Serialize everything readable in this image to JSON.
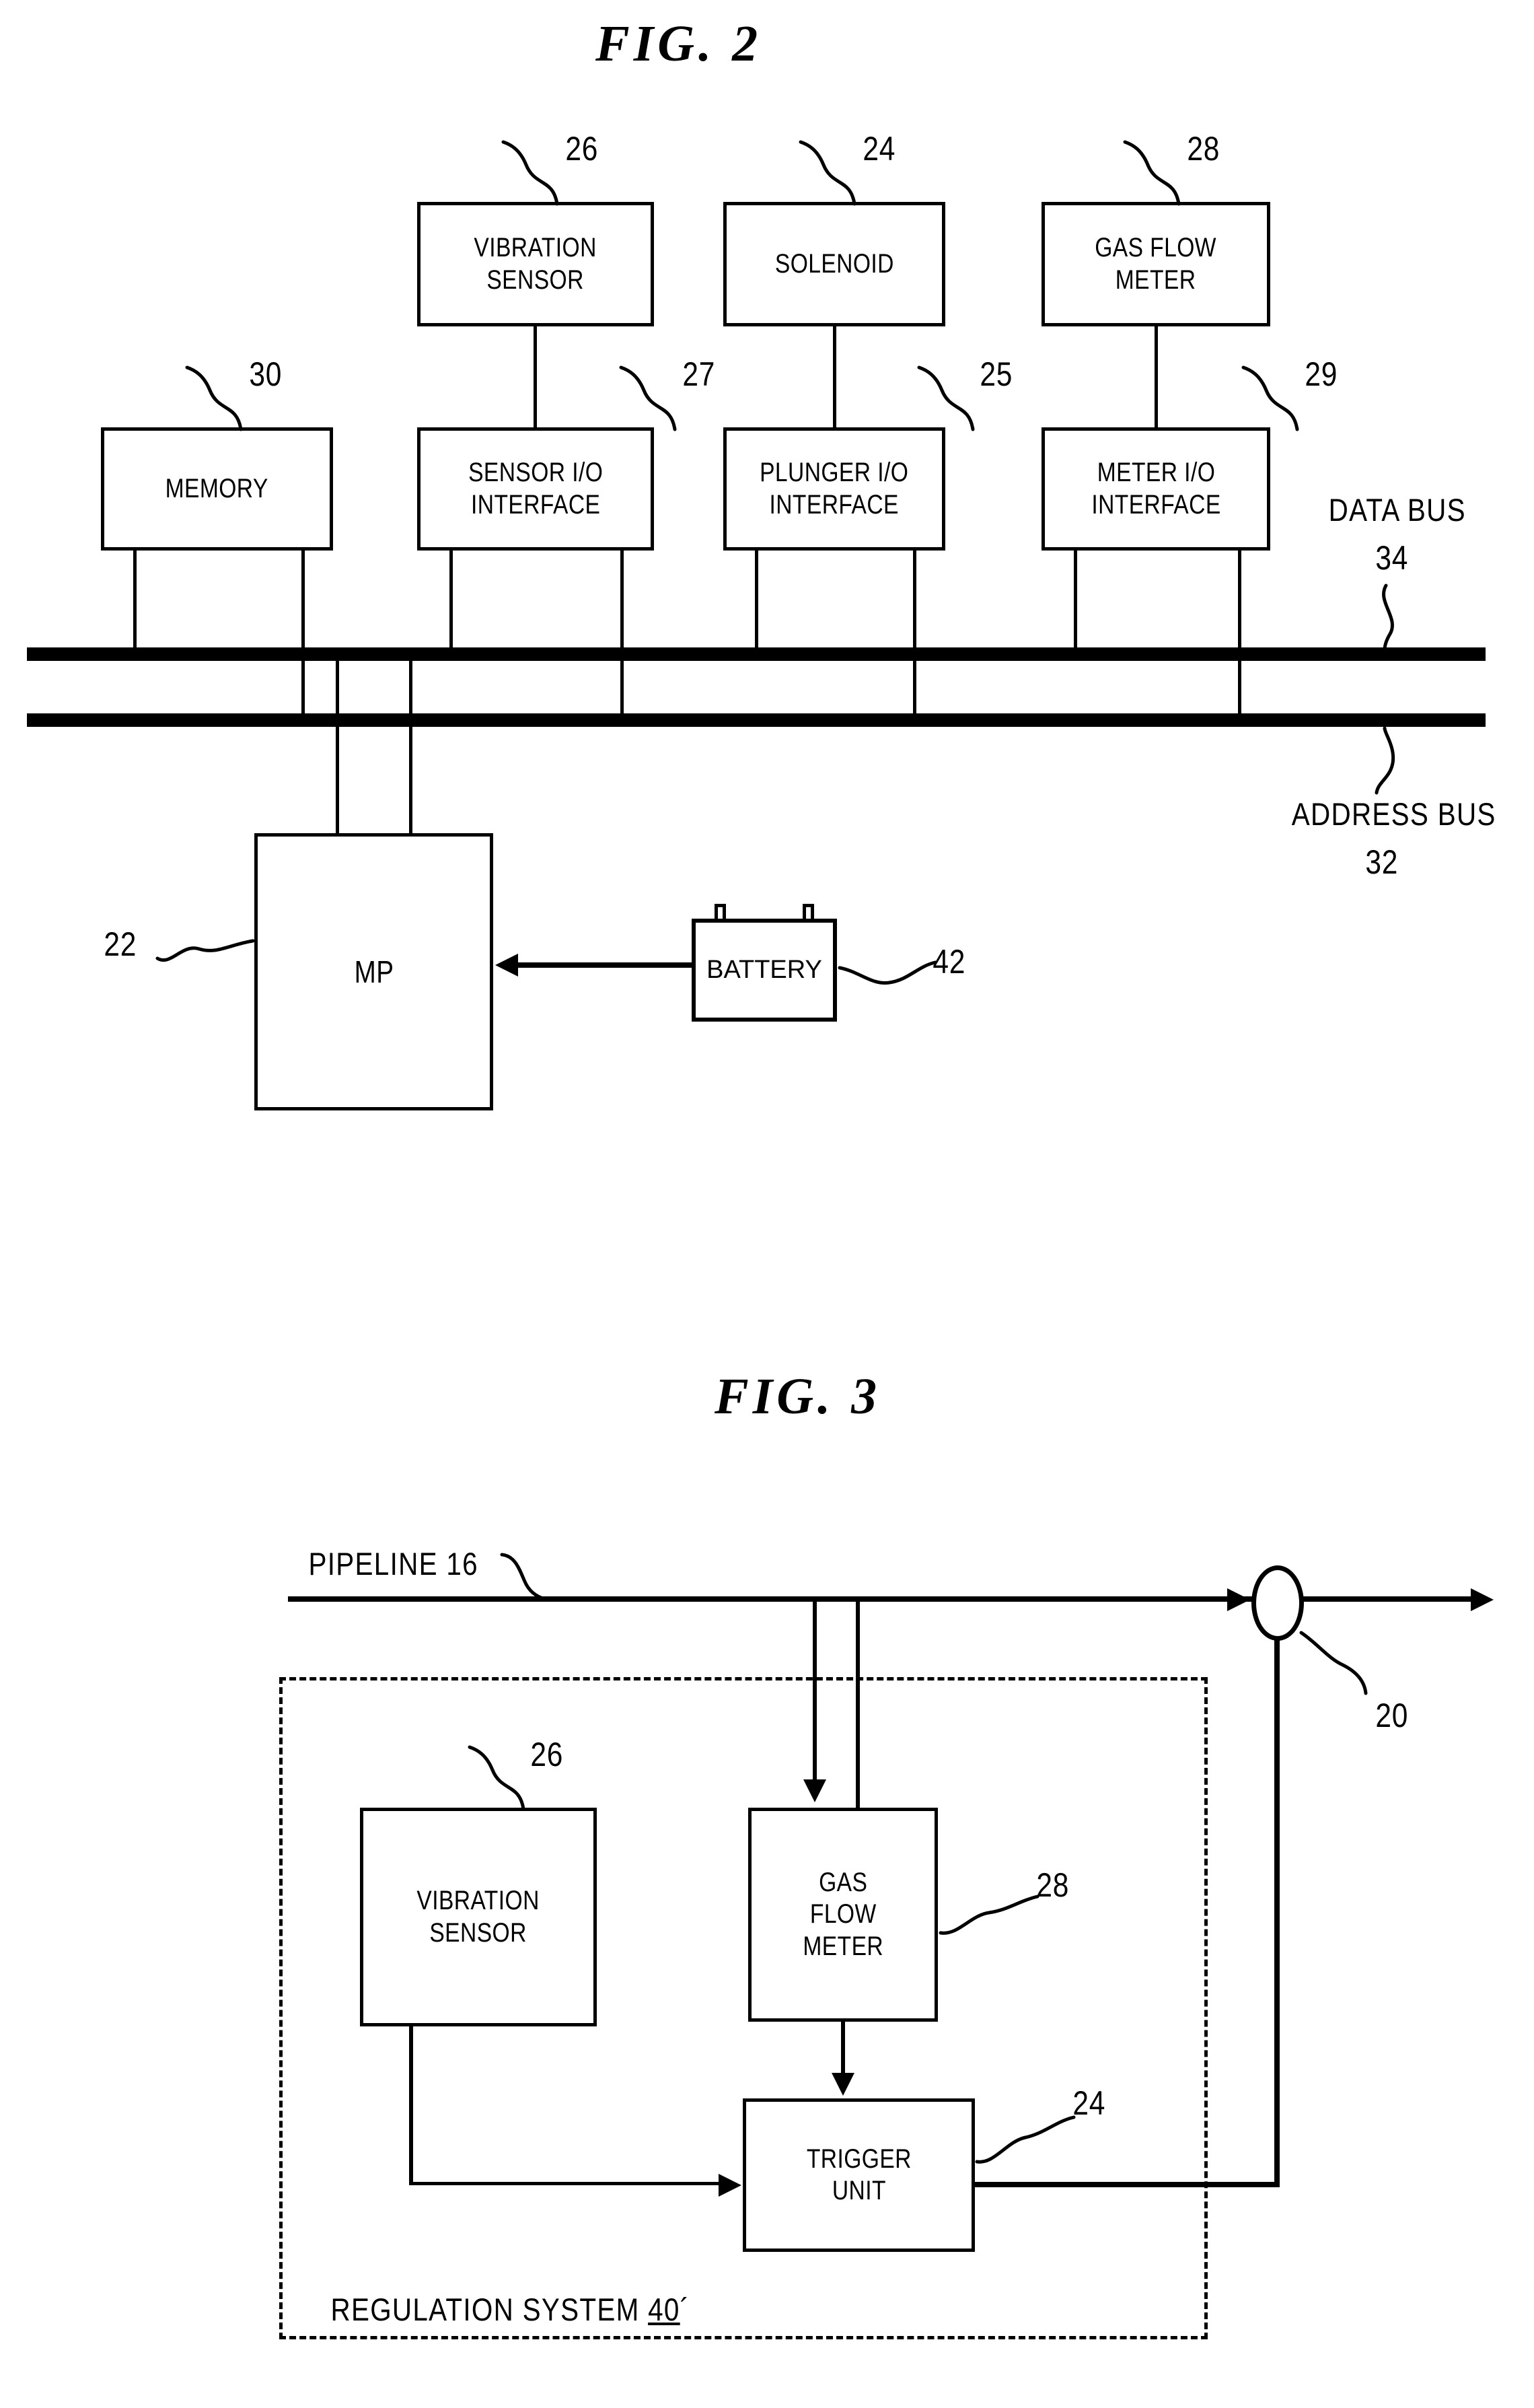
{
  "document": {
    "type": "patent-drawing-sheet",
    "figures": [
      "FIG. 2",
      "FIG. 3"
    ]
  },
  "fig2": {
    "title": "FIG. 2",
    "boxes": {
      "vibration_sensor": {
        "label": "VIBRATION\nSENSOR",
        "ref": "26"
      },
      "solenoid": {
        "label": "SOLENOID",
        "ref": "24"
      },
      "gas_flow_meter": {
        "label": "GAS FLOW\nMETER",
        "ref": "28"
      },
      "memory": {
        "label": "MEMORY",
        "ref": "30"
      },
      "sensor_io": {
        "label": "SENSOR I/O\nINTERFACE",
        "ref": "27"
      },
      "plunger_io": {
        "label": "PLUNGER I/O\nINTERFACE",
        "ref": "25"
      },
      "meter_io": {
        "label": "METER I/O\nINTERFACE",
        "ref": "29"
      },
      "mp": {
        "label": "MP",
        "ref": "22"
      },
      "battery": {
        "label": "BATTERY",
        "ref": "42"
      }
    },
    "buses": {
      "data_bus": {
        "label": "DATA BUS",
        "ref": "34"
      },
      "address_bus": {
        "label": "ADDRESS BUS",
        "ref": "32"
      }
    }
  },
  "fig3": {
    "title": "FIG. 3",
    "pipeline": {
      "label": "PIPELINE 16",
      "ref": "16"
    },
    "valve": {
      "ref": "20"
    },
    "boxes": {
      "vibration_sensor": {
        "label": "VIBRATION\nSENSOR",
        "ref": "26"
      },
      "gas_flow_meter": {
        "label": "GAS\nFLOW\nMETER",
        "ref": "28"
      },
      "trigger_unit": {
        "label": "TRIGGER\nUNIT",
        "ref": "24"
      }
    },
    "enclosure": {
      "label_prefix": "REGULATION SYSTEM ",
      "label_ref": "40",
      "prime": "´"
    }
  },
  "colors": {
    "ink": "#000000",
    "paper": "#ffffff"
  }
}
